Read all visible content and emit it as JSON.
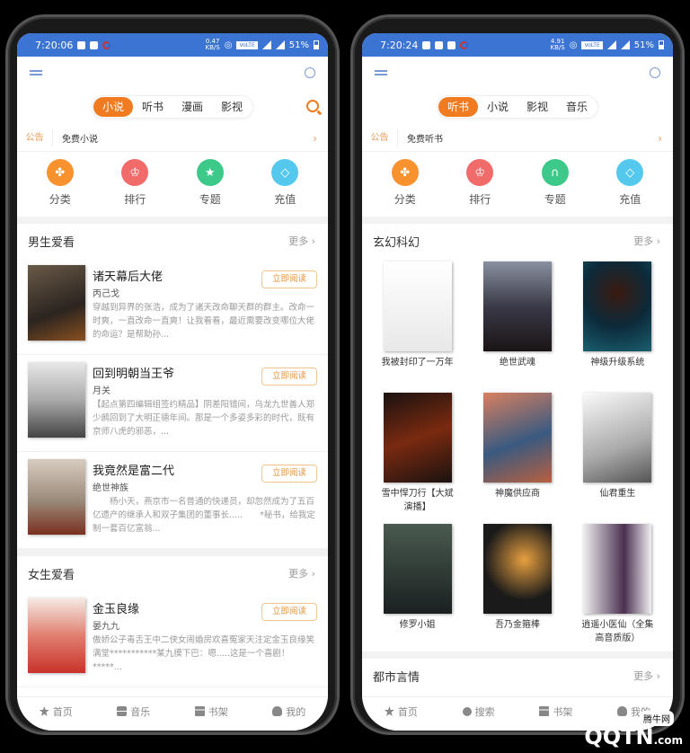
{
  "left": {
    "status": {
      "time": "7:20:06",
      "speed": "0.47",
      "speed_unit": "KB/S",
      "network": "VoLTE",
      "battery": "51%"
    },
    "tabs": [
      {
        "label": "小说",
        "active": true
      },
      {
        "label": "听书"
      },
      {
        "label": "漫画"
      },
      {
        "label": "影视"
      }
    ],
    "notice": {
      "tag": "公告",
      "text": "免费小说"
    },
    "quick": [
      {
        "label": "分类",
        "color": "#f7922e",
        "icon": "grid-icon"
      },
      {
        "label": "排行",
        "color": "#f26b6b",
        "icon": "trophy-icon"
      },
      {
        "label": "专题",
        "color": "#3dc98a",
        "icon": "star-icon"
      },
      {
        "label": "充值",
        "color": "#55c8ee",
        "icon": "diamond-icon"
      }
    ],
    "sections": [
      {
        "title": "男生爱看",
        "more": "更多",
        "books": [
          {
            "title": "诸天幕后大佬",
            "author": "丙己戈",
            "desc": "穿越到异界的张浩，成为了诸天改命聊天群的群主。改命一时爽，一直改命一直爽！让我看看，最近需要改变哪位大佬的命运？是帮助孙...",
            "button": "立即阅读",
            "cover": [
              "#2b2420",
              "#6a5a48"
            ]
          },
          {
            "title": "回到明朝当王爷",
            "author": "月关",
            "desc": "【起点第四编辑组签约精品】阴差阳错间，乌龙九世善人郑少鹧回到了大明正德年间。那是一个多姿多彩的时代，既有京师八虎的邪恶，...",
            "button": "立即阅读",
            "cover": [
              "#d8d8d8",
              "#555555"
            ]
          },
          {
            "title": "我竟然是富二代",
            "author": "绝世神族",
            "desc": "　　杨小天，燕京市一名普通的快递员，却忽然成为了五百亿遗产的继承人和双子集团的董事长.....　　*秘书，给我定制一套百亿富翁...",
            "button": "立即阅读",
            "cover": [
              "#cfc4b8",
              "#7a3020"
            ]
          }
        ]
      },
      {
        "title": "女生爱看",
        "more": "更多",
        "books": [
          {
            "title": "金玉良缘",
            "author": "晏九九",
            "desc": "傲娇公子毒舌王中二侠女闹婚房欢喜冤家天注定金玉良缘笑满堂***********某九摸下巴：嗯.....这是一个喜剧！*****...",
            "button": "立即阅读",
            "cover": [
              "#f5ece6",
              "#c8332a"
            ]
          }
        ]
      }
    ],
    "nav": [
      {
        "label": "首页",
        "icon": "star"
      },
      {
        "label": "音乐",
        "icon": "music"
      },
      {
        "label": "书架",
        "icon": "shelf"
      },
      {
        "label": "我的",
        "icon": "user"
      }
    ]
  },
  "right": {
    "status": {
      "time": "7:20:24",
      "speed": "4.91",
      "speed_unit": "KB/S",
      "network": "VoLTE",
      "battery": "51%"
    },
    "tabs": [
      {
        "label": "听书",
        "active": true
      },
      {
        "label": "小说"
      },
      {
        "label": "影视"
      },
      {
        "label": "音乐"
      }
    ],
    "notice": {
      "tag": "公告",
      "text": "免费听书"
    },
    "quick": [
      {
        "label": "分类",
        "color": "#f7922e",
        "icon": "grid-icon"
      },
      {
        "label": "排行",
        "color": "#f26b6b",
        "icon": "trophy-icon"
      },
      {
        "label": "专题",
        "color": "#3dc98a",
        "icon": "headphones-icon"
      },
      {
        "label": "充值",
        "color": "#55c8ee",
        "icon": "diamond-icon"
      }
    ],
    "sections": [
      {
        "title": "玄幻科幻",
        "more": "更多",
        "books": [
          {
            "title": "我被封印了一万年",
            "cover": [
              "#fafafa",
              "#cccccc"
            ]
          },
          {
            "title": "绝世武魂",
            "cover": [
              "#4a4e5a",
              "#1a1416"
            ]
          },
          {
            "title": "神级升级系统",
            "cover": [
              "#0c2a3a",
              "#1a6070"
            ]
          },
          {
            "title": "雪中悍刀行【大斌演播】",
            "cover": [
              "#1a1210",
              "#7a2a10"
            ]
          },
          {
            "title": "神魔供应商",
            "cover": [
              "#b86040",
              "#3a5a80"
            ]
          },
          {
            "title": "仙君重生",
            "cover": [
              "#f0f0f0",
              "#8a8a8a"
            ]
          },
          {
            "title": "修罗小姐",
            "cover": [
              "#3a4a40",
              "#1a2020"
            ]
          },
          {
            "title": "吾乃金箍棒",
            "cover": [
              "#1a1a1a",
              "#c87020"
            ]
          },
          {
            "title": "逍遥小医仙（全集高音质版）",
            "cover": [
              "#f0eef0",
              "#4a3050"
            ]
          }
        ]
      },
      {
        "title": "都市言情",
        "more": "更多"
      }
    ],
    "nav": [
      {
        "label": "首页",
        "icon": "star"
      },
      {
        "label": "搜索",
        "icon": "search"
      },
      {
        "label": "书架",
        "icon": "shelf"
      },
      {
        "label": "我的",
        "icon": "user"
      }
    ]
  },
  "watermark": {
    "text": "QQTN",
    "suffix": ".com",
    "badge": "腾牛网"
  }
}
